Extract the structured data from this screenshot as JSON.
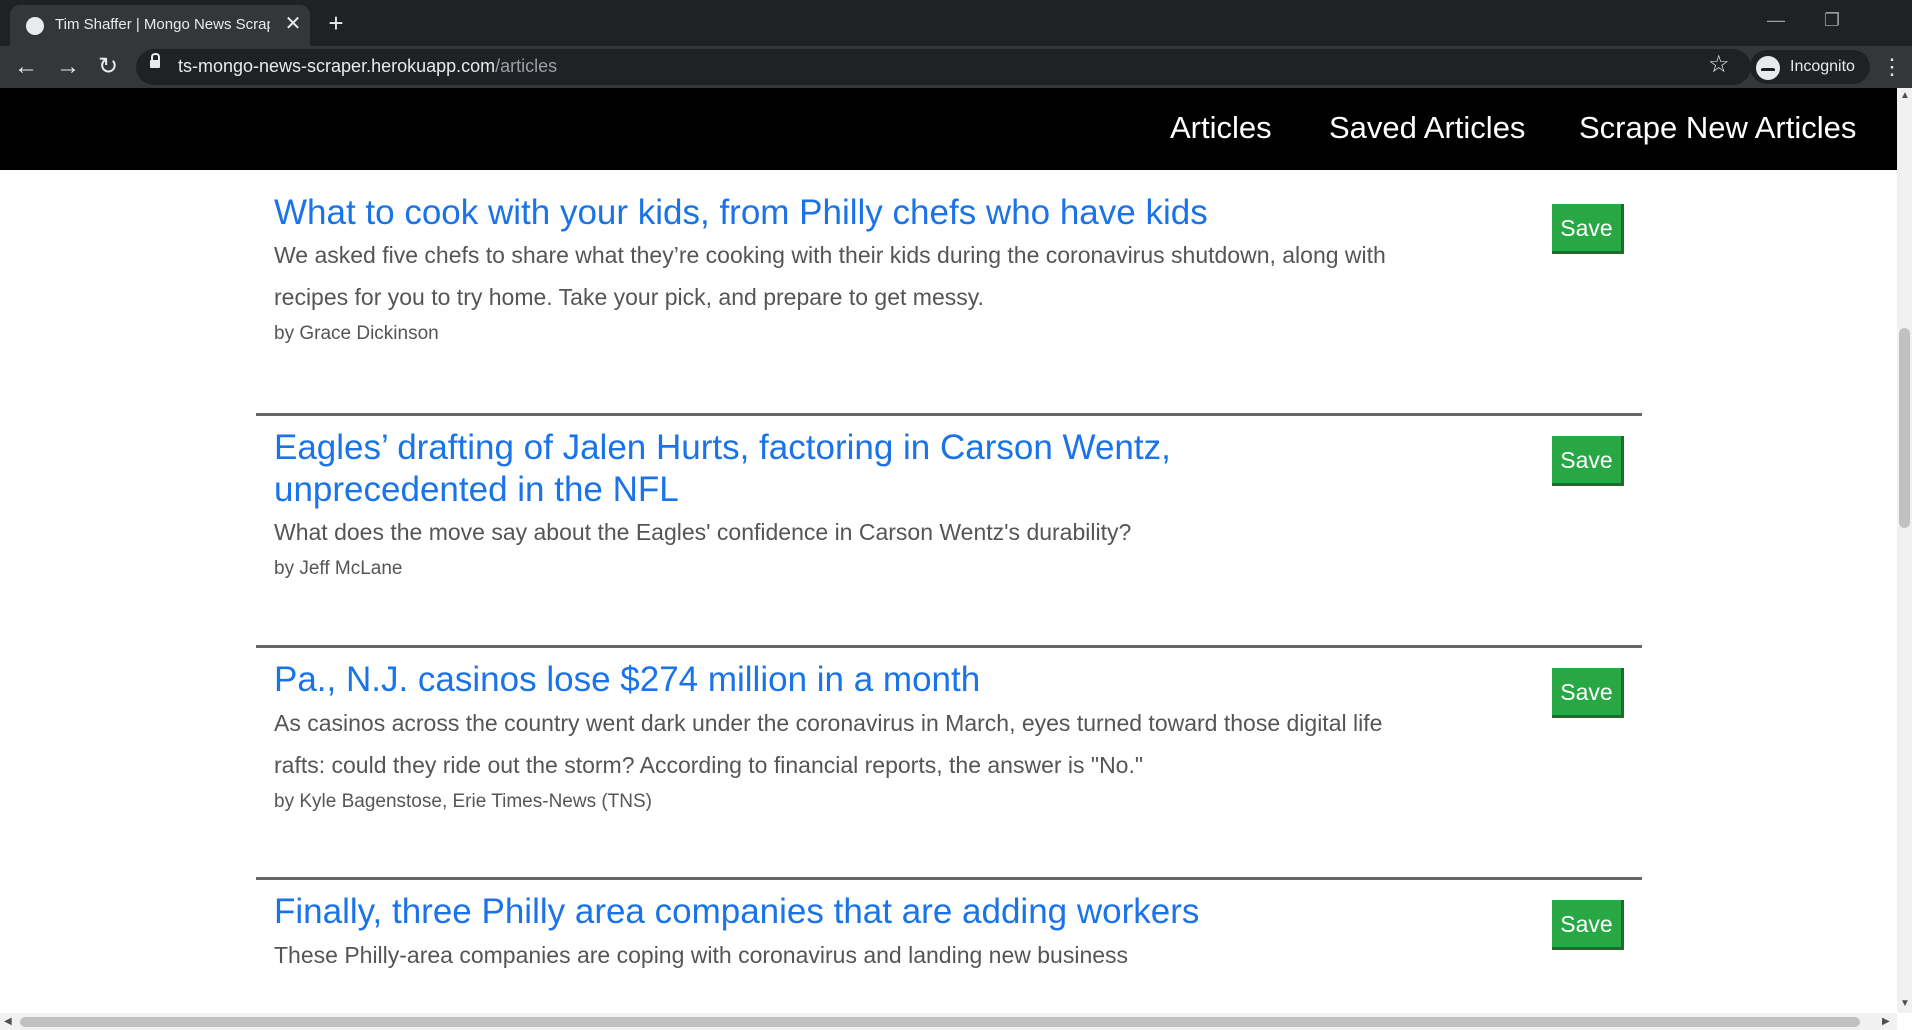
{
  "browser": {
    "tab_title": "Tim Shaffer | Mongo News Scrap",
    "tab_close": "✕",
    "new_tab": "+",
    "url_host": "ts-mongo-news-scraper.herokuapp.com",
    "url_path": "/articles",
    "profile_label": "Incognito",
    "icons": {
      "back": "←",
      "forward": "→",
      "reload": "↻",
      "star": "☆",
      "menu": "⋮",
      "minimize": "—",
      "restore": "❐"
    }
  },
  "site_nav": {
    "links": [
      "Articles",
      "Saved Articles",
      "Scrape New Articles"
    ]
  },
  "articles": [
    {
      "title": "What to cook with your kids, from Philly chefs who have kids",
      "summary": "We asked five chefs to share what they’re cooking with their kids during the coronavirus shutdown, along with recipes for you to try home. Take your pick, and prepare to get messy.",
      "author": "by Grace Dickinson",
      "save_label": "Save"
    },
    {
      "title": "Eagles’ drafting of Jalen Hurts, factoring in Carson Wentz, unprecedented in the NFL",
      "summary": "What does the move say about the Eagles' confidence in Carson Wentz's durability?",
      "author": "by Jeff McLane",
      "save_label": "Save"
    },
    {
      "title": "Pa., N.J. casinos lose $274 million in a month",
      "summary": "As casinos across the country went dark under the coronavirus in March, eyes turned toward those digital life rafts: could they ride out the storm? According to financial reports, the answer is \"No.\"",
      "author": "by Kyle Bagenstose, Erie Times-News (TNS)",
      "save_label": "Save"
    },
    {
      "title": "Finally, three Philly area companies that are adding workers",
      "summary": "These Philly-area companies are coping with coronavirus and landing new business",
      "author": "",
      "save_label": "Save"
    }
  ],
  "colors": {
    "link": "#1a73e8",
    "save_button": "#28a745",
    "nav_background": "#000000"
  }
}
